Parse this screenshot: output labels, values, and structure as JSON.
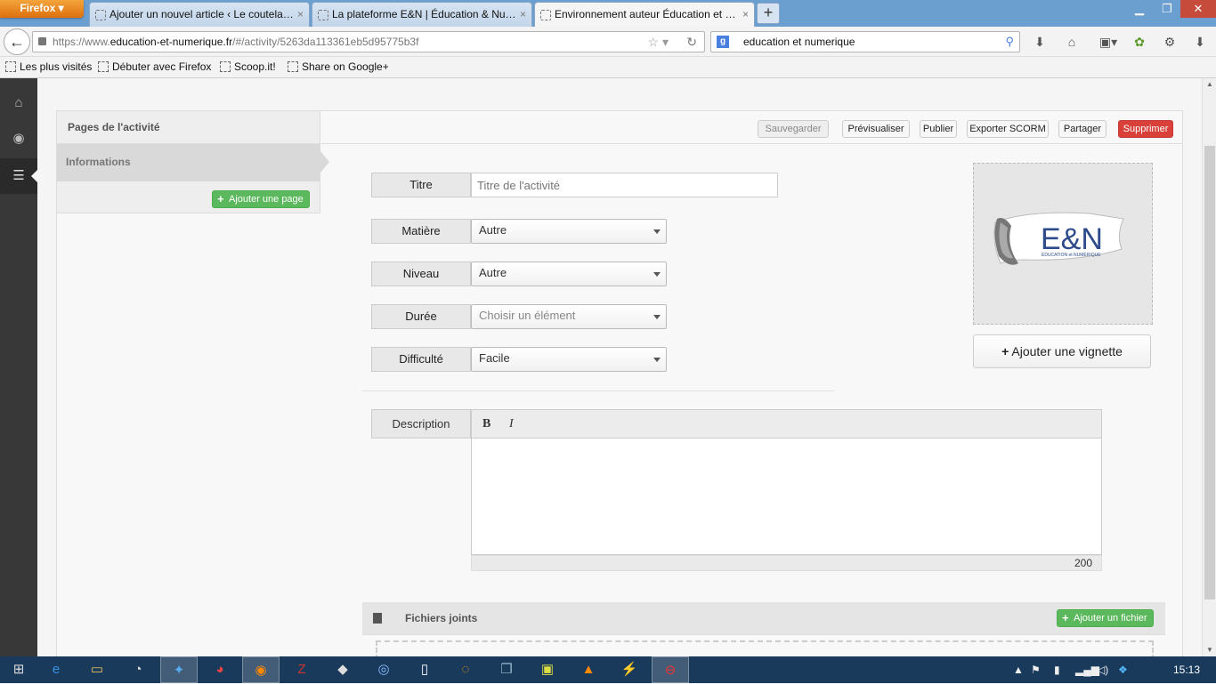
{
  "browser": {
    "menu_button": "Firefox",
    "tabs": [
      {
        "title": "Ajouter un nouvel article ‹ Le coutela…",
        "active": false
      },
      {
        "title": "La plateforme E&N | Éducation & Nu…",
        "active": false
      },
      {
        "title": "Environnement auteur Éducation et …",
        "active": true
      }
    ],
    "new_tab": "+",
    "tab_close": "×",
    "url_prefix": "https://www.",
    "url_domain": "education-et-numerique.fr",
    "url_path": "/#/activity/5263da113361eb5d95775b3f",
    "search_engine": "g",
    "search_text": "education et numerique",
    "bookmarks": [
      "Les plus visités",
      "Débuter avec Firefox",
      "Scoop.it!",
      "Share on Google+"
    ]
  },
  "pages_panel": {
    "header": "Pages de l'activité",
    "items": [
      "Informations"
    ],
    "add_page": "Ajouter une page"
  },
  "toolbar": {
    "save": "Sauvegarder",
    "preview": "Prévisualiser",
    "publish": "Publier",
    "export": "Exporter SCORM",
    "share": "Partager",
    "delete": "Supprimer"
  },
  "form": {
    "title_label": "Titre",
    "title_placeholder": "Titre de l'activité",
    "subject_label": "Matière",
    "subject_value": "Autre",
    "level_label": "Niveau",
    "level_value": "Autre",
    "duration_label": "Durée",
    "duration_value": "Choisir un élément",
    "difficulty_label": "Difficulté",
    "difficulty_value": "Facile",
    "description_label": "Description",
    "bold": "B",
    "italic": "I",
    "char_count": "200"
  },
  "thumbnail": {
    "logo_text": "E&N",
    "logo_sub": "ÉDUCATION et NUMÉRIQUE",
    "add_label": "Ajouter une vignette"
  },
  "attachments": {
    "label": "Fichiers joints",
    "add_label": "Ajouter un fichier"
  },
  "taskbar": {
    "clock": "15:13"
  },
  "colors": {
    "danger": "#d9403a",
    "success": "#5cb85c",
    "sidebar": "#383838",
    "logo_blue": "#2d4a8a"
  }
}
